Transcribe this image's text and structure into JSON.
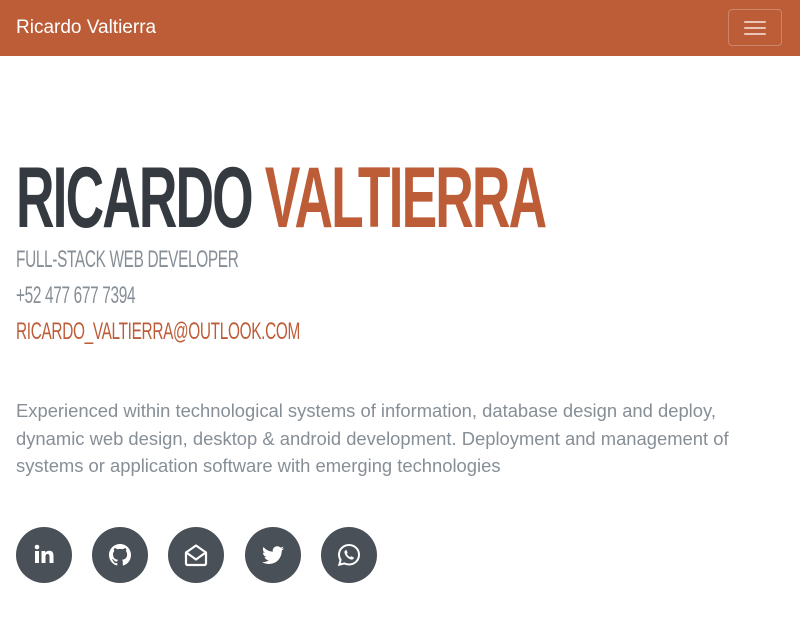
{
  "navbar": {
    "brand": "Ricardo Valtierra",
    "toggle_icon": "hamburger-menu-icon",
    "background_color": "#bd5d38"
  },
  "hero": {
    "first_name": "RICARDO",
    "last_name": "VALTIERRA",
    "role": "FULL-STACK WEB DEVELOPER",
    "phone": "+52 477 677 7394",
    "email": "RICARDO_VALTIERRA@OUTLOOK.COM",
    "description": "Experienced within technological systems of information, database design and deploy, dynamic web design, desktop & android development. Deployment and management of systems or application software with emerging technologies"
  },
  "social": [
    {
      "icon": "linkedin-icon"
    },
    {
      "icon": "github-icon"
    },
    {
      "icon": "envelope-open-icon"
    },
    {
      "icon": "twitter-icon"
    },
    {
      "icon": "whatsapp-icon"
    }
  ],
  "colors": {
    "accent": "#bd5d38",
    "dark": "#343a40",
    "muted": "#868e96",
    "social_bg": "#495057"
  }
}
